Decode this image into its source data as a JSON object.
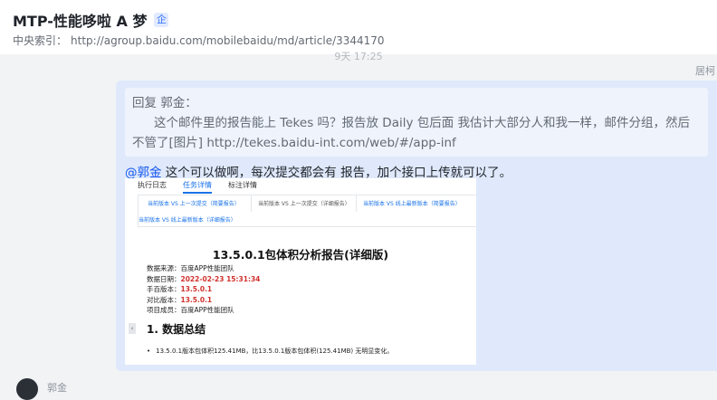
{
  "header": {
    "title": "MTP-性能哆啦 A 梦",
    "badge": "企",
    "index_label": "中央索引：",
    "index_url": "http://agroup.baidu.com/mobilebaidu/md/article/3344170"
  },
  "timestamp": "9天 17:25",
  "sender_name": "居柯",
  "message": {
    "quote_line1": "回复 郭金：",
    "quote_line2": "这个邮件里的报告能上 Tekes 吗？报告放 Daily 包后面 我估计大部分人和我一样，邮件分组，然后",
    "quote_line3": "不管了[图片] http://tekes.baidu-int.com/web/#/app-inf",
    "mention": "@郭金",
    "reply_text": " 这个可以做啊，每次提交都会有 报告，加个接口上传就可以了。"
  },
  "embedded_report": {
    "tabs": [
      "执行日志",
      "任务详情",
      "标注详情"
    ],
    "active_tab": "任务详情",
    "subtabs": [
      "当前版本 VS 上一次提交（简要报告）",
      "当前版本 VS 上一次提交（详细报告）",
      "当前版本 VS 线上最新版本（简要报告）",
      "当前版本 VS 线上最新版本（详细报告）"
    ],
    "title": "13.5.0.1包体积分析报告(详细版)",
    "meta": [
      {
        "label": "数据来源：",
        "value": "百度APP性能团队",
        "highlight": false
      },
      {
        "label": "数据日期：",
        "value": "2022-02-23 15:31:34",
        "highlight": true
      },
      {
        "label": "手百版本：",
        "value": "13.5.0.1",
        "highlight": true
      },
      {
        "label": "对比版本：",
        "value": "13.5.0.1",
        "highlight": true
      },
      {
        "label": "项目成员：",
        "value": "百度APP性能团队",
        "highlight": false
      }
    ],
    "section_title": "1. 数据总结",
    "bullet": "13.5.0.1版本包体积125.41MB，比13.5.0.1版本包体积(125.41MB) 无明显变化。",
    "handle_glyph": "‹"
  },
  "next_sender": "郭金",
  "colors": {
    "accent": "#1456f0",
    "bubble": "#dfe9fb",
    "highlight_red": "#d0312d"
  }
}
